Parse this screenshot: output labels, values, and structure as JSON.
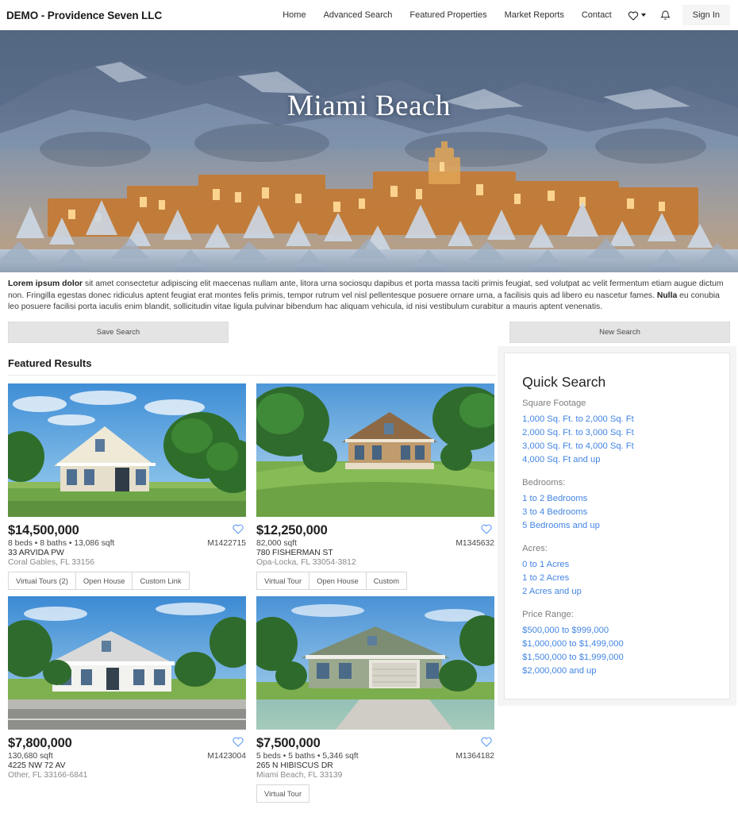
{
  "header": {
    "brand": "DEMO - Providence Seven LLC",
    "nav_links": [
      "Home",
      "Advanced Search",
      "Featured Properties",
      "Market Reports",
      "Contact"
    ],
    "favorites_icon": "heart-icon",
    "favorites_caret": "chevron-down-icon",
    "notifications_icon": "bell-icon",
    "sign_in_label": "Sign In"
  },
  "hero": {
    "title": "Miami Beach",
    "image_alt": "snowy mountain town at twilight with warmly lit adobe buildings"
  },
  "description": {
    "lead": "Lorem ipsum dolor",
    "body_1": " sit amet consectetur adipiscing elit maecenas nullam ante, litora urna sociosqu dapibus et porta massa taciti primis feugiat, sed volutpat ac velit fermentum etiam augue dictum non. Fringilla egestas donec ridiculus aptent feugiat erat montes felis primis, tempor rutrum vel nisl pellentesque posuere ornare urna, a facilisis quis ad libero eu nascetur fames. ",
    "bold_2": "Nulla",
    "body_2": " eu conubia leo posuere facilisi porta iaculis enim blandit, sollicitudin vitae ligula pulvinar bibendum hac aliquam vehicula, id nisi vestibulum curabitur a mauris aptent venenatis."
  },
  "actions": {
    "save_search": "Save Search",
    "new_search": "New Search"
  },
  "results": {
    "section_title": "Featured Results",
    "cards": [
      {
        "price": "$14,500,000",
        "specs": "8  beds • 8  baths • 13,086 sqft",
        "mls": "M1422715",
        "address": "33 ARVIDA PW",
        "city": "Coral Gables, FL 33156",
        "favorite_icon": "heart-icon",
        "tags": [
          "Virtual Tours (2)",
          "Open House",
          "Custom Link"
        ],
        "photo": "two-story cream victorian house with green lawn and blue sky"
      },
      {
        "price": "$12,250,000",
        "specs": "82,000 sqft",
        "mls": "M1345632",
        "address": "780 FISHERMAN ST",
        "city": "Opa-Locka, FL 33054-3812",
        "favorite_icon": "heart-icon",
        "tags": [
          "Virtual Tour",
          "Open House",
          "Custom"
        ],
        "photo": "tan victorian house on sloping green lawn with trees"
      },
      {
        "price": "$7,800,000",
        "specs": "130,680 sqft",
        "mls": "M1423004",
        "address": "4225 NW 72 AV",
        "city": "Other, FL 33166-6841",
        "favorite_icon": "heart-icon",
        "tags": [],
        "photo": "white craftsman house with front lawn and street"
      },
      {
        "price": "$7,500,000",
        "specs": "5  beds • 5  baths • 5,346 sqft",
        "mls": "M1364182",
        "address": "265 N HIBISCUS DR",
        "city": "Miami Beach, FL 33139",
        "favorite_icon": "heart-icon",
        "tags": [
          "Virtual Tour"
        ],
        "photo": "sage green craftsman house with two-car garage and driveway"
      }
    ]
  },
  "quick_search": {
    "title": "Quick Search",
    "groups": [
      {
        "label": "Square Footage",
        "links": [
          "1,000 Sq. Ft. to 2,000 Sq. Ft",
          "2,000 Sq. Ft. to 3,000 Sq. Ft",
          "3,000 Sq. Ft. to 4,000 Sq. Ft",
          "4,000 Sq. Ft and up"
        ]
      },
      {
        "label": "Bedrooms:",
        "links": [
          "1 to 2 Bedrooms",
          "3 to 4 Bedrooms",
          "5 Bedrooms and up"
        ]
      },
      {
        "label": "Acres:",
        "links": [
          "0 to 1 Acres",
          "1 to 2 Acres",
          "2 Acres and up"
        ]
      },
      {
        "label": "Price Range:",
        "links": [
          "$500,000 to $999,000",
          "$1,000,000 to $1,499,000",
          "$1,500,000 to $1,999,000",
          "$2,000,000 and up"
        ]
      }
    ]
  },
  "colors": {
    "link_blue": "#4285e4",
    "heart_blue": "#5b9bf8",
    "button_gray": "#e4e4e4",
    "muted_text": "#8a8a8a"
  }
}
